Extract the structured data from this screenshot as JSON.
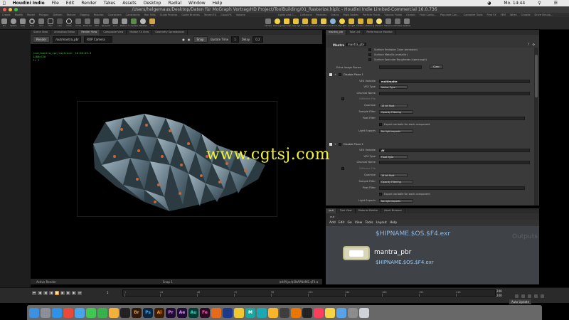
{
  "menubar": {
    "app": "Houdini Indie",
    "items": [
      "File",
      "Edit",
      "Render",
      "Takes",
      "Assets",
      "Desktop",
      "Radial",
      "Window",
      "Help"
    ],
    "clock": "Mo. 14:44"
  },
  "window": {
    "title": "/Users/helgemaus/Desktop/Daten für MoGraph Vortrag/HD Project/ToolBuilding/01_Rasterize.hiplc - Houdini Indie Limited-Commercial 16.0.736"
  },
  "shelf": {
    "tabs": [
      "Create",
      "Modify",
      "Model",
      "Polygon",
      "Deform",
      "Texture",
      "Rigging",
      "Muscles",
      "Characters",
      "Constraints",
      "Hair Utils",
      "Guide Process",
      "Guide Brushes",
      "Terrain FX",
      "Cloud FX",
      "Volume"
    ],
    "tools": [
      "Box",
      "Sphere",
      "Tube",
      "Torus",
      "Grid",
      "Null",
      "Line",
      "Circle",
      "Curve",
      "Draw Curve",
      "Path",
      "Spray Paint",
      "Font",
      "Platonic Solids",
      "L-System",
      "Metaball",
      "File"
    ],
    "light_tabs": [
      "Lights and C...",
      "Collisions",
      "Particles",
      "Grains",
      "Rigid Bodies",
      "Particle Fluids",
      "Viscous Fluids",
      "Oceans",
      "Fluid Conta...",
      "Populate Con...",
      "Container Tools",
      "Pyro FX",
      "FEM",
      "Wires",
      "Crowds",
      "Drive Simula..."
    ],
    "light_tools": [
      "Camera",
      "Point Light",
      "Spot Light",
      "Area Light",
      "Geometry Light",
      "Volume Light",
      "Distant Light",
      "Environment Light",
      "Sky Light",
      "GI Light",
      "Caustic Light",
      "Portal Light",
      "Ambient Light",
      "Stereo Camera",
      "VR Camera",
      "Switcher"
    ]
  },
  "viewport": {
    "tabs": [
      "Scene View",
      "Animation Editor",
      "Render View",
      "Composite View",
      "Motion FX View",
      "Geometry Spreadsheet"
    ],
    "active_tab": "Render View",
    "path": "/out",
    "node": "/out/mantra_pbr",
    "camera": "ROP Camera",
    "snap_label": "Snap",
    "update_time_label": "Update Time",
    "update_time_value": "1",
    "delay_label": "Delay",
    "delay_value": "0.2",
    "render_button": "Render",
    "info_lines": [
      "/out/mantra_ipr/raytrace: 16:06:03.3",
      "1280×720",
      "fr 1"
    ],
    "status_left": "Active Render",
    "status_snap": "Snap 1",
    "status_file": "$HIP/ipr/$SNAPNAME.$F4.$"
  },
  "params": {
    "tabs": [
      "mantra_pbr",
      "Take List",
      "Performance Monitor"
    ],
    "node_type": "Mantra",
    "node_name": "mantra_pbr",
    "top_checks": [
      "Surface Emission Color (emission)",
      "Surface Metallic (metallic)",
      "Surface Specular Roughness (specrough)"
    ],
    "extra_plane_label": "Extra Image Planes",
    "clear_button": "Clear",
    "plane1": {
      "header": "Disable Plane 1",
      "vex_variable_label": "VEX Variable",
      "vex_variable_value": "multimatte",
      "vex_type_label": "VEX Type",
      "vex_type_value": "Vector Type",
      "channel_label": "Channel Name",
      "diff_file_label": "Different File",
      "quantize_label": "Quantize",
      "quantize_value": "16 bit float",
      "sample_filter_label": "Sample Filter",
      "sample_filter_value": "Opacity Filtering",
      "pixel_filter_label": "Pixel Filter",
      "export_label": "Export variable for each component",
      "light_exports_label": "Light Exports",
      "light_exports_value": "No light exports"
    },
    "plane2": {
      "header": "Disable Plane 2",
      "vex_variable_label": "VEX Variable",
      "vex_variable_value": "Af",
      "vex_type_label": "VEX Type",
      "vex_type_value": "Float Type",
      "channel_label": "Channel Name",
      "diff_file_label": "Different File",
      "quantize_label": "Quantize",
      "quantize_value": "16 bit float",
      "sample_filter_label": "Sample Filter",
      "sample_filter_value": "Opacity Filtering",
      "pixel_filter_label": "Pixel Filter",
      "export_label": "Export variable for each component",
      "light_exports_label": "Light Exports",
      "light_exports_value": "No light exports"
    }
  },
  "network": {
    "tabs": [
      "/out",
      "Tree View",
      "Material Palette",
      "Asset Browser"
    ],
    "path": "out",
    "menu": [
      "Add",
      "Edit",
      "Go",
      "View",
      "Tools",
      "Layout",
      "Help"
    ],
    "ghost_text": "$HIPNAME.$OS.$F4.exr",
    "outputs_label": "Outputs",
    "node_name": "mantra_pbr",
    "node_path": "$HIPNAME.$OS.$F4.exr"
  },
  "timeline": {
    "frame": "1",
    "ticks": [
      "1",
      "24",
      "48",
      "72",
      "96",
      "120",
      "144",
      "168",
      "192",
      "216"
    ],
    "range_end_a": "240",
    "range_end_b": "240",
    "auto_update": "Auto Update"
  },
  "dock": {
    "apps": [
      "Finder",
      "Launchpad",
      "Safari",
      "Chrome",
      "Mail",
      "Messages",
      "FaceTime",
      "Photos",
      "Terminal",
      "Br",
      "Ps",
      "Ai",
      "Pr",
      "Ae",
      "Au",
      "Fe",
      "Houdini",
      "C4D",
      "Nuke",
      "M",
      "Maya",
      "Sketch",
      "Resolve",
      "Blender",
      "Unity",
      "Music",
      "Notes",
      "Preview",
      "Prefs",
      "Trash"
    ]
  },
  "watermark": "www.cgtsj.com",
  "colors": {
    "accent_orange": "#e49a1f",
    "terminal_green": "#44cc44",
    "node_path_blue": "#9ec8f0",
    "watermark_yellow": "#f2f230"
  }
}
